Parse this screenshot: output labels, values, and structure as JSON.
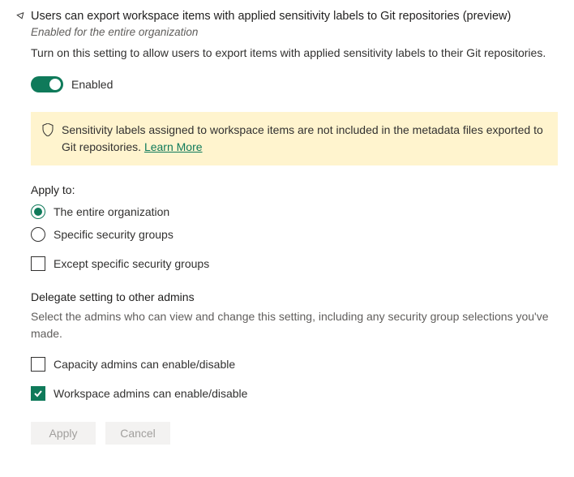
{
  "title": "Users can export workspace items with applied sensitivity labels to Git repositories (preview)",
  "scope": "Enabled for the entire organization",
  "description": "Turn on this setting to allow users to export items with applied sensitivity labels to their Git repositories.",
  "toggle": {
    "label": "Enabled"
  },
  "info": {
    "text": "Sensitivity labels assigned to workspace items are not included in the metadata files exported to Git repositories. ",
    "link": "Learn More"
  },
  "applyTo": {
    "label": "Apply to:",
    "options": [
      "The entire organization",
      "Specific security groups"
    ],
    "except": "Except specific security groups"
  },
  "delegate": {
    "title": "Delegate setting to other admins",
    "description": "Select the admins who can view and change this setting, including any security group selections you've made.",
    "capacity": "Capacity admins can enable/disable",
    "workspace": "Workspace admins can enable/disable"
  },
  "buttons": {
    "apply": "Apply",
    "cancel": "Cancel"
  }
}
